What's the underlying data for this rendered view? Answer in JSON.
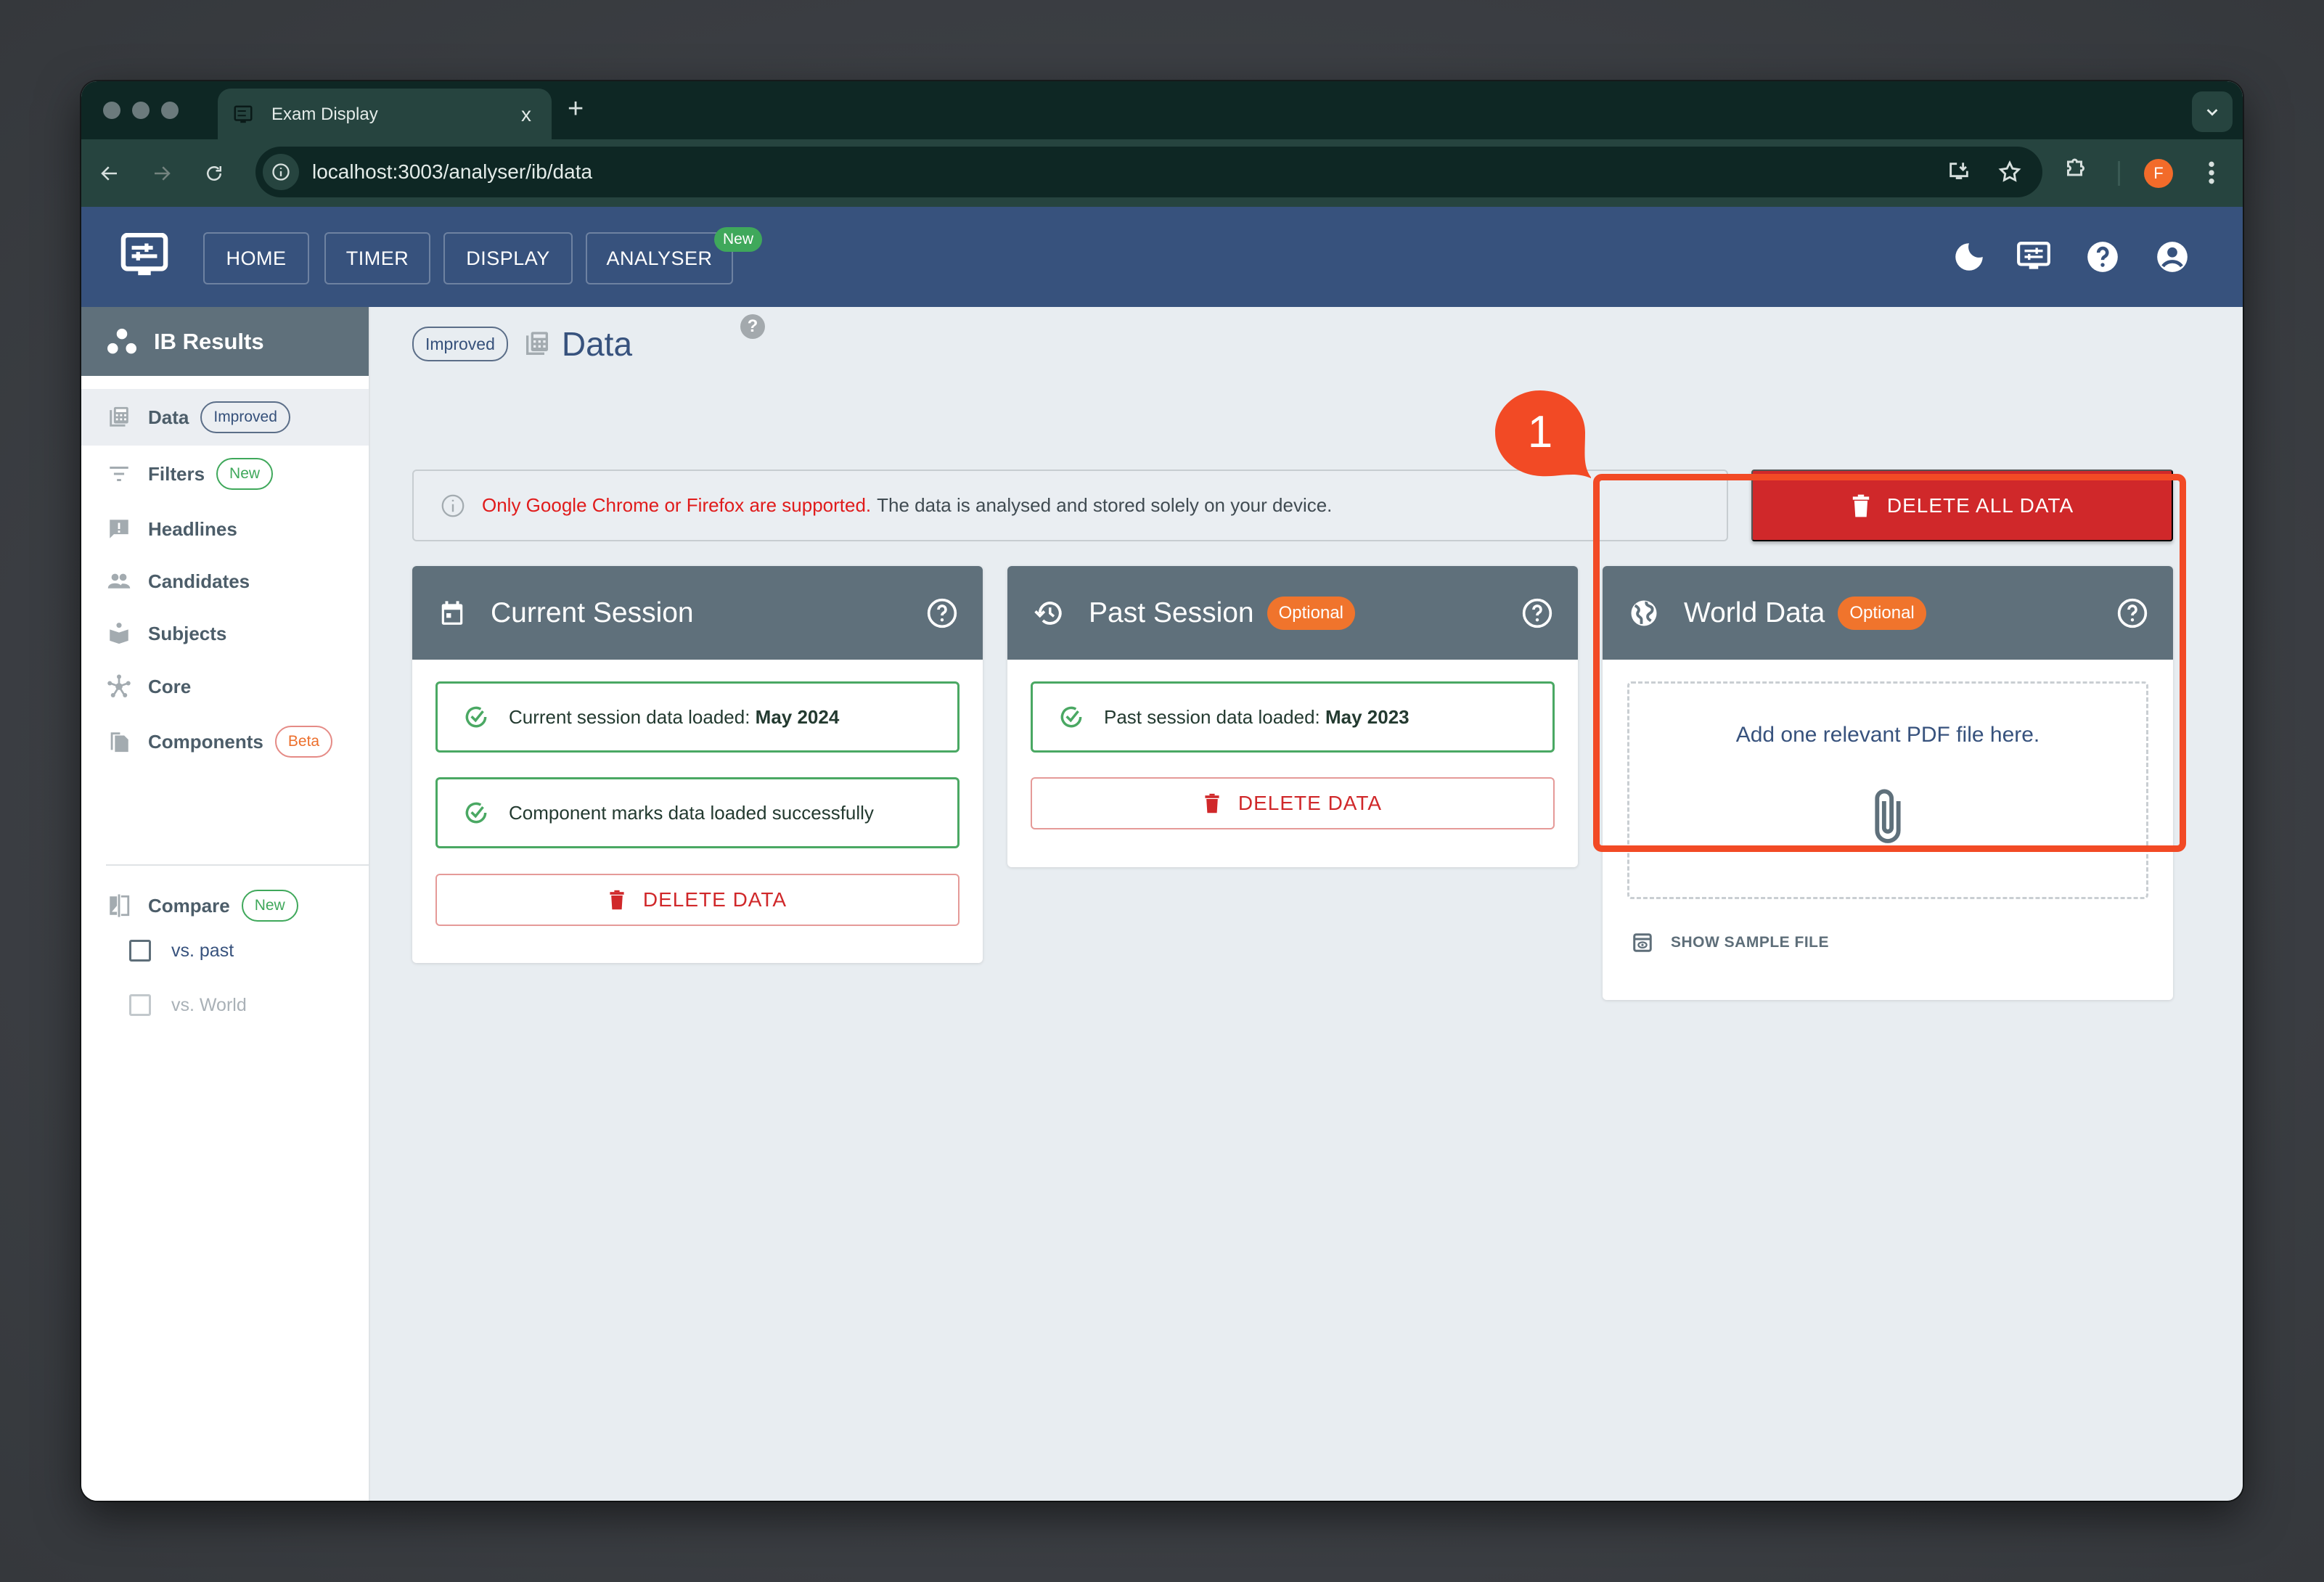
{
  "browser": {
    "tab_title": "Exam Display",
    "tab_close": "x",
    "new_tab": "+",
    "url": "localhost:3003/analyser/ib/data",
    "profile_initial": "F"
  },
  "appbar": {
    "nav": [
      {
        "label": "HOME"
      },
      {
        "label": "TIMER"
      },
      {
        "label": "DISPLAY"
      },
      {
        "label": "ANALYSER",
        "badge": "New"
      }
    ],
    "icons": [
      "moon-icon",
      "display-settings-icon",
      "help-icon",
      "account-icon"
    ]
  },
  "sidebar": {
    "title": "IB Results",
    "items": [
      {
        "label": "Data",
        "badge": "Improved",
        "active": true
      },
      {
        "label": "Filters",
        "badge": "New"
      },
      {
        "label": "Headlines"
      },
      {
        "label": "Candidates"
      },
      {
        "label": "Subjects"
      },
      {
        "label": "Core"
      },
      {
        "label": "Components",
        "badge": "Beta"
      }
    ],
    "compare": {
      "label": "Compare",
      "badge": "New",
      "options": [
        {
          "label": "vs. past",
          "checked": false,
          "disabled": false
        },
        {
          "label": "vs. World",
          "checked": false,
          "disabled": true
        }
      ]
    }
  },
  "page": {
    "badge": "Improved",
    "title": "Data",
    "help": "?",
    "alert": {
      "warning": "Only Google Chrome or Firefox are supported.",
      "text": "The data is analysed and stored solely on your device."
    },
    "delete_all_label": "DELETE ALL DATA"
  },
  "cards": {
    "current": {
      "title": "Current Session",
      "status1_prefix": "Current session data loaded:",
      "status1_value": "May 2024",
      "status2": "Component marks data loaded successfully",
      "delete_label": "DELETE DATA"
    },
    "past": {
      "title": "Past Session",
      "badge": "Optional",
      "status_prefix": "Past session data loaded:",
      "status_value": "May 2023",
      "delete_label": "DELETE DATA"
    },
    "world": {
      "title": "World Data",
      "badge": "Optional",
      "dropzone_text": "Add one relevant PDF file here.",
      "show_sample_label": "SHOW SAMPLE FILE"
    }
  },
  "annotation": {
    "step_number": "1",
    "color": "#f24a25"
  },
  "colors": {
    "appbar": "#37527d",
    "card_header": "#5f707b",
    "danger": "#d0282a",
    "success": "#4aa863",
    "optional_badge": "#f0742c"
  }
}
